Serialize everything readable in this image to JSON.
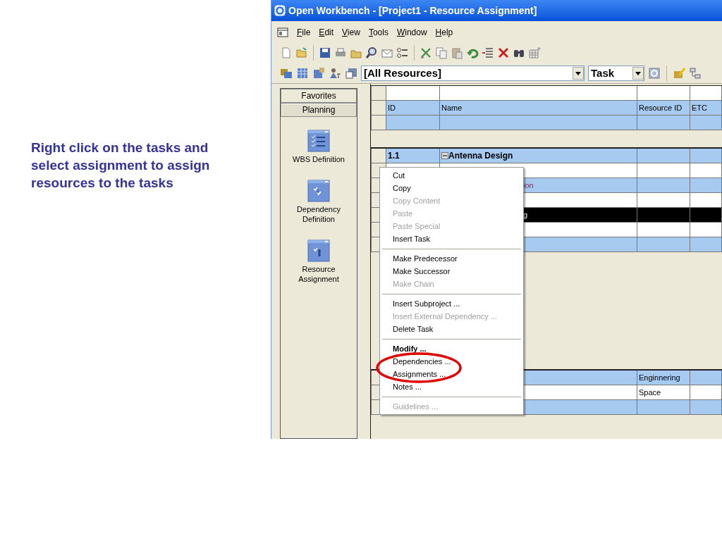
{
  "caption": "Right click on the tasks and select assignment to assign resources to the tasks",
  "window": {
    "title": "Open Workbench - [Project1 - Resource Assignment]"
  },
  "menu_bar": [
    "File",
    "Edit",
    "View",
    "Tools",
    "Window",
    "Help"
  ],
  "filters": {
    "resource_filter": "[All Resources]",
    "view_by": "Task"
  },
  "sidebar": {
    "tabs": [
      {
        "label": "Favorites",
        "selected": false
      },
      {
        "label": "Planning",
        "selected": true
      }
    ],
    "items": [
      {
        "label": "WBS Definition",
        "kind": "wbs"
      },
      {
        "label": "Dependency Definition",
        "kind": "dependency"
      },
      {
        "label": "Resource Assignment",
        "kind": "resource"
      }
    ]
  },
  "resource_table": {
    "columns": [
      "ID",
      "Name",
      "Resource ID",
      "ETC"
    ]
  },
  "task_table": {
    "rows": [
      {
        "id": "1.1",
        "name": "Antenna Design",
        "kind": "summary",
        "expanded": true,
        "critical": false,
        "selected": false
      },
      {
        "kind": "task",
        "selected": false
      },
      {
        "name": "ion",
        "kind": "task",
        "critical": true,
        "selected": false
      },
      {
        "kind": "task",
        "selected": false
      },
      {
        "name": "g",
        "kind": "task",
        "critical": false,
        "selected": true
      },
      {
        "kind": "task",
        "selected": false
      },
      {
        "kind": "task",
        "selected": false
      }
    ]
  },
  "assignment_table": {
    "rows": [
      {
        "resource_id": "Enginnering"
      },
      {
        "resource_id": "Space"
      },
      {}
    ]
  },
  "context_menu": [
    {
      "kind": "item",
      "label": "Cut",
      "disabled": false
    },
    {
      "kind": "item",
      "label": "Copy",
      "disabled": false
    },
    {
      "kind": "item",
      "label": "Copy Content",
      "disabled": true
    },
    {
      "kind": "item",
      "label": "Paste",
      "disabled": true
    },
    {
      "kind": "item",
      "label": "Paste Special",
      "disabled": true
    },
    {
      "kind": "item",
      "label": "Insert Task",
      "disabled": false
    },
    {
      "kind": "separator"
    },
    {
      "kind": "item",
      "label": "Make Predecessor",
      "disabled": false
    },
    {
      "kind": "item",
      "label": "Make Successor",
      "disabled": false
    },
    {
      "kind": "item",
      "label": "Make Chain",
      "disabled": true
    },
    {
      "kind": "separator"
    },
    {
      "kind": "item",
      "label": "Insert Subproject ...",
      "disabled": false
    },
    {
      "kind": "item",
      "label": "Insert External Dependency ...",
      "disabled": true
    },
    {
      "kind": "item",
      "label": "Delete Task",
      "disabled": false
    },
    {
      "kind": "separator"
    },
    {
      "kind": "item",
      "label": "Modify ...",
      "disabled": false,
      "default": true
    },
    {
      "kind": "item",
      "label": "Dependencies ...",
      "disabled": false
    },
    {
      "kind": "item",
      "label": "Assignments ...",
      "disabled": false
    },
    {
      "kind": "item",
      "label": "Notes ...",
      "disabled": false
    },
    {
      "kind": "separator"
    },
    {
      "kind": "item",
      "label": "Guidelines ...",
      "disabled": true
    }
  ]
}
